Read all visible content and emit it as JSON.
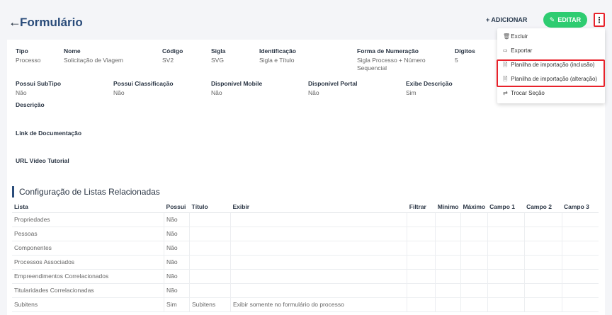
{
  "header": {
    "back_icon": "arrow-left-icon",
    "title": "Formulário",
    "add_label": "+ ADICIONAR",
    "edit_label": "EDITAR",
    "menu_glyph": "⋮"
  },
  "details": {
    "tipo_label": "Tipo",
    "tipo_value": "Processo",
    "nome_label": "Nome",
    "nome_value": "Solicitação de Viagem",
    "codigo_label": "Código",
    "codigo_value": "SV2",
    "sigla_label": "Sigla",
    "sigla_value": "SVG",
    "identificacao_label": "Identificação",
    "identificacao_value": "Sigla e Título",
    "numeracao_label": "Forma de Numeração",
    "numeracao_value_1": "Sigla Processo + Número",
    "numeracao_value_2": "Sequencial",
    "digitos_label": "Dígitos",
    "digitos_value": "5",
    "subtipo_label": "Possui SubTipo",
    "subtipo_value": "Não",
    "classificacao_label": "Possui Classificação",
    "classificacao_value": "Não",
    "mobile_label": "Disponível Mobile",
    "mobile_value": "Não",
    "portal_label": "Disponível Portal",
    "portal_value": "Não",
    "exibe_label": "Exibe Descrição",
    "exibe_value": "Sim",
    "descricao_label": "Descrição",
    "link_label": "Link de Documentação",
    "url_label": "URL Vídeo Tutorial"
  },
  "section": {
    "title": "Configuração de Listas Relacionadas"
  },
  "table": {
    "headers": [
      "Lista",
      "Possui",
      "Título",
      "Exibir",
      "Filtrar",
      "Mínimo",
      "Máximo",
      "Campo 1",
      "Campo 2",
      "Campo 3"
    ],
    "rows": [
      [
        "Propriedades",
        "Não",
        "",
        "",
        "",
        "",
        "",
        "",
        "",
        ""
      ],
      [
        "Pessoas",
        "Não",
        "",
        "",
        "",
        "",
        "",
        "",
        "",
        ""
      ],
      [
        "Componentes",
        "Não",
        "",
        "",
        "",
        "",
        "",
        "",
        "",
        ""
      ],
      [
        "Processos Associados",
        "Não",
        "",
        "",
        "",
        "",
        "",
        "",
        "",
        ""
      ],
      [
        "Empreendimentos Correlacionados",
        "Não",
        "",
        "",
        "",
        "",
        "",
        "",
        "",
        ""
      ],
      [
        "Titularidades Correlacionadas",
        "Não",
        "",
        "",
        "",
        "",
        "",
        "",
        "",
        ""
      ],
      [
        "Subitens",
        "Sim",
        "Subitens",
        "Exibir somente no formulário do processo",
        "",
        "",
        "",
        "",
        "",
        ""
      ]
    ]
  },
  "menu": {
    "items": [
      {
        "icon": "trash-icon",
        "glyph": "🗑",
        "label": "Excluir"
      },
      {
        "icon": "export-icon",
        "glyph": "⇨",
        "label": "Exportar"
      },
      {
        "icon": "file-icon",
        "glyph": "🗎",
        "label": "Planilha de importação (inclusão)"
      },
      {
        "icon": "file-icon",
        "glyph": "🗎",
        "label": "Planilha de importação (alteração)"
      },
      {
        "icon": "swap-icon",
        "glyph": "⇄",
        "label": "Trocar Seção"
      }
    ]
  },
  "colors": {
    "accent": "#2a4c7a",
    "edit_button": "#2ecc71",
    "highlight": "#e8222b"
  }
}
